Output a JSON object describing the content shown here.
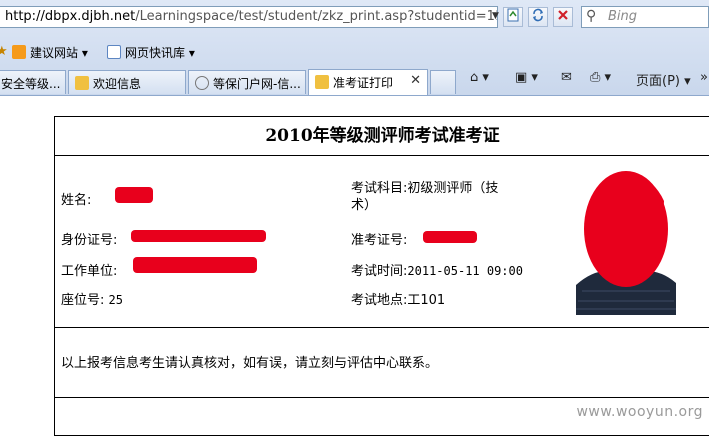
{
  "browser": {
    "url_domain": "http://dbpx.djbh.net",
    "url_path": "/Learningspace/test/student/zkz_print.asp?studentid=110718",
    "search_placeholder": "Bing",
    "favorites": [
      {
        "label": "建议网站 ▾"
      },
      {
        "label": "网页快讯库 ▾"
      }
    ],
    "tabs": [
      {
        "label": "安全等级..."
      },
      {
        "label": "欢迎信息"
      },
      {
        "label": "等保门户网-信..."
      },
      {
        "label": "准考证打印"
      }
    ],
    "tools": {
      "home": "⌂ ▾",
      "feeds": "▣ ▾",
      "mail": "✉",
      "print": "⎙ ▾",
      "page": "页面(P) ▾"
    }
  },
  "document": {
    "title": "2010年等级测评师考试准考证",
    "left_fields": [
      {
        "label": "姓名:",
        "value": ""
      },
      {
        "label": "身份证号:",
        "value": ""
      },
      {
        "label": "工作单位:",
        "value": ""
      },
      {
        "label": "座位号:",
        "value": "25"
      }
    ],
    "right_fields": [
      {
        "label": "考试科目:",
        "value": "初级测评师（技",
        "value2": "术）"
      },
      {
        "label": "准考证号:",
        "value": ""
      },
      {
        "label": "考试时间:",
        "value": "2011-05-11 09:00"
      },
      {
        "label": "考试地点:",
        "value": "工101"
      }
    ],
    "notice": "以上报考信息考生请认真核对，如有误，请立刻与评估中心联系。"
  },
  "watermark": "www.wooyun.org",
  "colors": {
    "redaction": "#e8001c",
    "chrome": "#dfe8f6"
  }
}
